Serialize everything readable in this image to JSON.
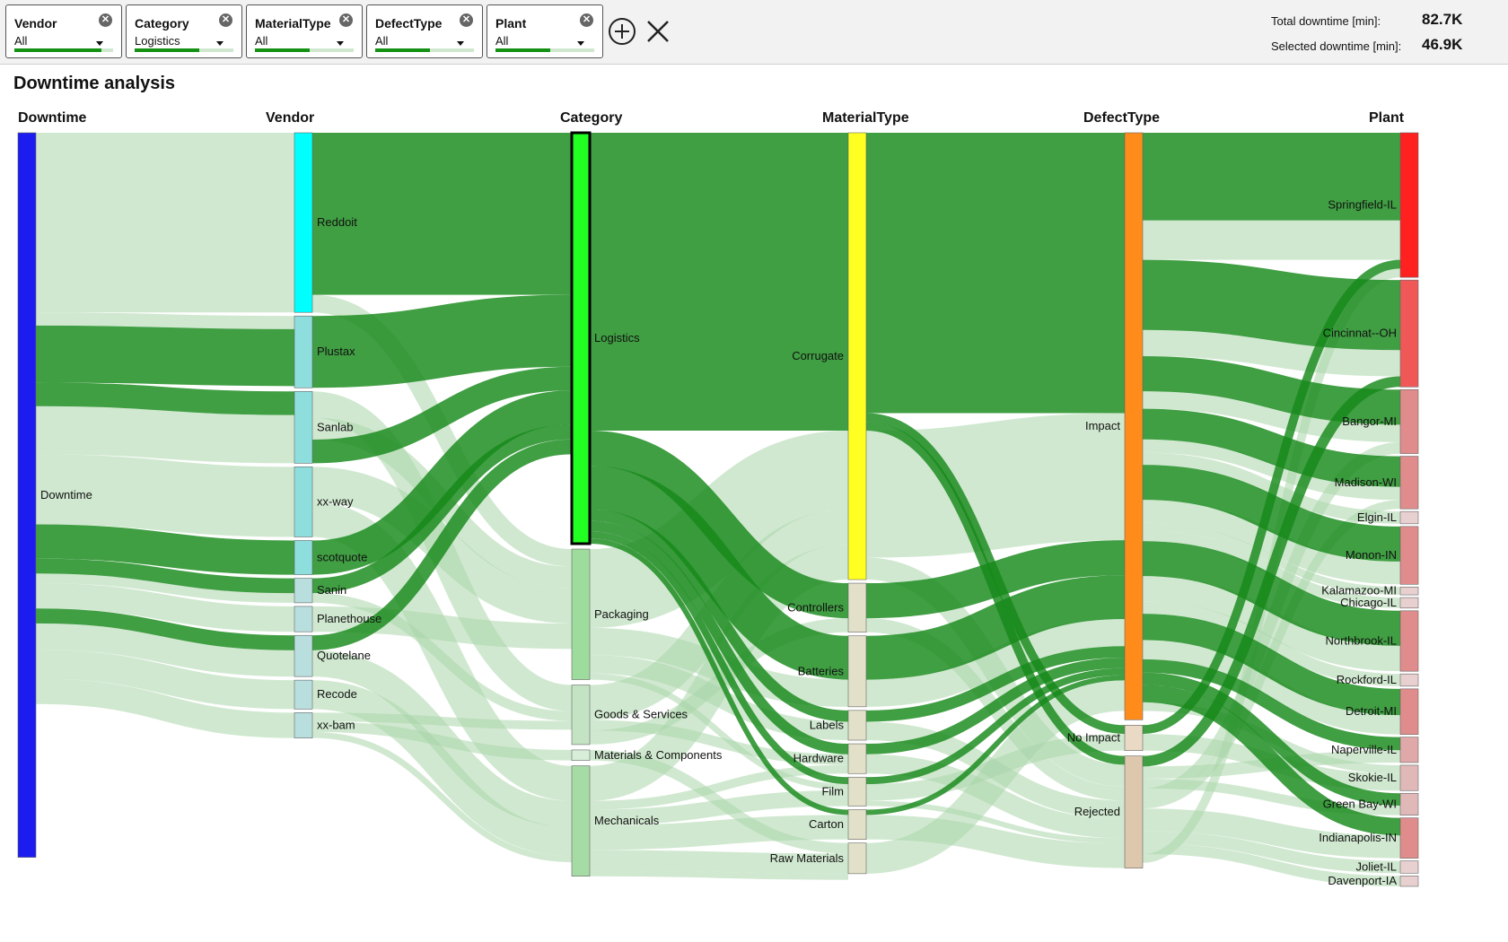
{
  "filters": [
    {
      "name": "Vendor",
      "value": "All",
      "fill": 0.88
    },
    {
      "name": "Category",
      "value": "Logistics",
      "fill": 0.65
    },
    {
      "name": "MaterialType",
      "value": "All",
      "fill": 0.55
    },
    {
      "name": "DefectType",
      "value": "All",
      "fill": 0.55
    },
    {
      "name": "Plant",
      "value": "All",
      "fill": 0.55
    }
  ],
  "totals": {
    "total_label": "Total downtime [min]:",
    "total_value": "82.7K",
    "selected_label": "Selected downtime [min]:",
    "selected_value": "46.9K"
  },
  "title": "Downtime analysis",
  "colors": {
    "link_selected": "#16891a",
    "link_other": "#a9d6a9",
    "highlight": "#22ff22"
  },
  "chart_data": {
    "type": "sankey",
    "columns": [
      "Downtime",
      "Vendor",
      "Category",
      "MaterialType",
      "DefectType",
      "Plant"
    ],
    "nodes": [
      {
        "col": 0,
        "label": "Downtime",
        "value": 82.7,
        "color": "#1c1cf0"
      },
      {
        "col": 1,
        "label": "Reddoit",
        "value": 20.5,
        "color": "#00ffff"
      },
      {
        "col": 1,
        "label": "Plustax",
        "value": 8.2,
        "color": "#8fdede"
      },
      {
        "col": 1,
        "label": "Sanlab",
        "value": 8.2,
        "color": "#8fdede"
      },
      {
        "col": 1,
        "label": "xx-way",
        "value": 8.0,
        "color": "#8fdede"
      },
      {
        "col": 1,
        "label": "scotquote",
        "value": 3.9,
        "color": "#8fdede"
      },
      {
        "col": 1,
        "label": "Sanin",
        "value": 2.8,
        "color": "#b9dede"
      },
      {
        "col": 1,
        "label": "Planethouse",
        "value": 2.9,
        "color": "#b9dede"
      },
      {
        "col": 1,
        "label": "Quotelane",
        "value": 4.7,
        "color": "#b9dede"
      },
      {
        "col": 1,
        "label": "Recode",
        "value": 3.3,
        "color": "#b9dede"
      },
      {
        "col": 1,
        "label": "xx-bam",
        "value": 2.9,
        "color": "#b9dede"
      },
      {
        "col": 2,
        "label": "Logistics",
        "value": 46.9,
        "color": "#22ff22"
      },
      {
        "col": 2,
        "label": "Packaging",
        "value": 14.9,
        "color": "#9ddc9d"
      },
      {
        "col": 2,
        "label": "Goods & Services",
        "value": 6.8,
        "color": "#c3e3c3"
      },
      {
        "col": 2,
        "label": "Materials & Components",
        "value": 1.2,
        "color": "#d9eed9"
      },
      {
        "col": 2,
        "label": "Mechanicals",
        "value": 12.6,
        "color": "#a6dba6"
      },
      {
        "col": 3,
        "label": "Corrugate",
        "value": 51.0,
        "color": "#ffff22"
      },
      {
        "col": 3,
        "label": "Controllers",
        "value": 5.6,
        "color": "#e2e0c8"
      },
      {
        "col": 3,
        "label": "Batteries",
        "value": 8.1,
        "color": "#e2e0c8"
      },
      {
        "col": 3,
        "label": "Labels",
        "value": 3.4,
        "color": "#e2e0c8"
      },
      {
        "col": 3,
        "label": "Hardware",
        "value": 3.4,
        "color": "#e2e0c8"
      },
      {
        "col": 3,
        "label": "Film",
        "value": 3.3,
        "color": "#e2e0c8"
      },
      {
        "col": 3,
        "label": "Carton",
        "value": 3.4,
        "color": "#e2e0c8"
      },
      {
        "col": 3,
        "label": "Raw Materials",
        "value": 3.5,
        "color": "#e2e0c8"
      },
      {
        "col": 4,
        "label": "Impact",
        "value": 67.0,
        "color": "#ff8c1a"
      },
      {
        "col": 4,
        "label": "No Impact",
        "value": 2.9,
        "color": "#ead9c4"
      },
      {
        "col": 4,
        "label": "Rejected",
        "value": 12.8,
        "color": "#ddc7ad"
      },
      {
        "col": 5,
        "label": "Springfield-IL",
        "value": 16.5,
        "color": "#ff2020"
      },
      {
        "col": 5,
        "label": "Cincinnat--OH",
        "value": 12.2,
        "color": "#f05858"
      },
      {
        "col": 5,
        "label": "Bangor-MI",
        "value": 7.3,
        "color": "#e08c8c"
      },
      {
        "col": 5,
        "label": "Madison-WI",
        "value": 6.0,
        "color": "#e08c8c"
      },
      {
        "col": 5,
        "label": "Elgin-IL",
        "value": 1.4,
        "color": "#e8d0d0"
      },
      {
        "col": 5,
        "label": "Monon-IN",
        "value": 6.6,
        "color": "#e08c8c"
      },
      {
        "col": 5,
        "label": "Kalamazoo-MI",
        "value": 0.9,
        "color": "#e8d0d0"
      },
      {
        "col": 5,
        "label": "Chicago-IL",
        "value": 1.2,
        "color": "#e8d0d0"
      },
      {
        "col": 5,
        "label": "Northbrook-IL",
        "value": 6.9,
        "color": "#e08c8c"
      },
      {
        "col": 5,
        "label": "Rockford-IL",
        "value": 1.4,
        "color": "#e8d0d0"
      },
      {
        "col": 5,
        "label": "Detroit-MI",
        "value": 5.2,
        "color": "#e08c8c"
      },
      {
        "col": 5,
        "label": "Naperville-IL",
        "value": 2.9,
        "color": "#e0a8a8"
      },
      {
        "col": 5,
        "label": "Skokie-IL",
        "value": 2.9,
        "color": "#e0b8b8"
      },
      {
        "col": 5,
        "label": "Green Bay-WI",
        "value": 2.5,
        "color": "#e0b8b8"
      },
      {
        "col": 5,
        "label": "Indianapolis-IN",
        "value": 4.6,
        "color": "#e08c8c"
      },
      {
        "col": 5,
        "label": "Joliet-IL",
        "value": 1.4,
        "color": "#e8d0d0"
      },
      {
        "col": 5,
        "label": "Davenport-IA",
        "value": 1.2,
        "color": "#e8d0d0"
      }
    ],
    "links": [
      {
        "from": "Downtime",
        "to": "Reddoit",
        "value": 20.5,
        "selected": false
      },
      {
        "from": "Downtime",
        "to": "Plustax",
        "value": 1.5,
        "selected": false
      },
      {
        "from": "Downtime",
        "to": "Plustax",
        "value": 6.5,
        "selected": true
      },
      {
        "from": "Downtime",
        "to": "Sanlab",
        "value": 2.7,
        "selected": true
      },
      {
        "from": "Downtime",
        "to": "Sanlab",
        "value": 5.5,
        "selected": false
      },
      {
        "from": "Downtime",
        "to": "xx-way",
        "value": 8.0,
        "selected": false
      },
      {
        "from": "Downtime",
        "to": "scotquote",
        "value": 3.9,
        "selected": true
      },
      {
        "from": "Downtime",
        "to": "Sanin",
        "value": 1.7,
        "selected": true
      },
      {
        "from": "Downtime",
        "to": "Sanin",
        "value": 1.1,
        "selected": false
      },
      {
        "from": "Downtime",
        "to": "Planethouse",
        "value": 2.9,
        "selected": false
      },
      {
        "from": "Downtime",
        "to": "Quotelane",
        "value": 1.7,
        "selected": true
      },
      {
        "from": "Downtime",
        "to": "Quotelane",
        "value": 3.0,
        "selected": false
      },
      {
        "from": "Downtime",
        "to": "Recode",
        "value": 3.3,
        "selected": false
      },
      {
        "from": "Downtime",
        "to": "xx-bam",
        "value": 2.9,
        "selected": false
      },
      {
        "from": "Reddoit",
        "to": "Logistics",
        "value": 18.5,
        "selected": true
      },
      {
        "from": "Reddoit",
        "to": "Packaging",
        "value": 2.0,
        "selected": false
      },
      {
        "from": "Plustax",
        "to": "Logistics",
        "value": 8.2,
        "selected": true
      },
      {
        "from": "Sanlab",
        "to": "Goods & Services",
        "value": 3.0,
        "selected": false
      },
      {
        "from": "Sanlab",
        "to": "Packaging",
        "value": 2.5,
        "selected": false
      },
      {
        "from": "Sanlab",
        "to": "Logistics",
        "value": 2.7,
        "selected": true
      },
      {
        "from": "xx-way",
        "to": "Packaging",
        "value": 4.0,
        "selected": false
      },
      {
        "from": "xx-way",
        "to": "Mechanicals",
        "value": 4.0,
        "selected": false
      },
      {
        "from": "scotquote",
        "to": "Logistics",
        "value": 3.9,
        "selected": true
      },
      {
        "from": "Sanin",
        "to": "Logistics",
        "value": 1.7,
        "selected": true
      },
      {
        "from": "Sanin",
        "to": "Goods & Services",
        "value": 1.1,
        "selected": false
      },
      {
        "from": "Planethouse",
        "to": "Packaging",
        "value": 2.9,
        "selected": false
      },
      {
        "from": "Quotelane",
        "to": "Logistics",
        "value": 1.7,
        "selected": true
      },
      {
        "from": "Quotelane",
        "to": "Mechanicals",
        "value": 3.0,
        "selected": false
      },
      {
        "from": "Recode",
        "to": "Mechanicals",
        "value": 3.3,
        "selected": false
      },
      {
        "from": "xx-bam",
        "to": "Goods & Services",
        "value": 1.0,
        "selected": false
      },
      {
        "from": "xx-bam",
        "to": "Materials & Components",
        "value": 1.2,
        "selected": false
      },
      {
        "from": "xx-bam",
        "to": "Mechanicals",
        "value": 0.7,
        "selected": false
      },
      {
        "from": "Logistics",
        "to": "Corrugate",
        "value": 34.0,
        "selected": true
      },
      {
        "from": "Logistics",
        "to": "Controllers",
        "value": 4.0,
        "selected": true
      },
      {
        "from": "Logistics",
        "to": "Batteries",
        "value": 5.0,
        "selected": true
      },
      {
        "from": "Logistics",
        "to": "Labels",
        "value": 1.3,
        "selected": true
      },
      {
        "from": "Logistics",
        "to": "Hardware",
        "value": 1.2,
        "selected": true
      },
      {
        "from": "Logistics",
        "to": "Film",
        "value": 0.8,
        "selected": true
      },
      {
        "from": "Logistics",
        "to": "Carton",
        "value": 0.6,
        "selected": true
      },
      {
        "from": "Packaging",
        "to": "Corrugate",
        "value": 9.0,
        "selected": false
      },
      {
        "from": "Packaging",
        "to": "Batteries",
        "value": 3.1,
        "selected": false
      },
      {
        "from": "Packaging",
        "to": "Labels",
        "value": 2.1,
        "selected": false
      },
      {
        "from": "Packaging",
        "to": "Film",
        "value": 0.7,
        "selected": false
      },
      {
        "from": "Goods & Services",
        "to": "Corrugate",
        "value": 4.0,
        "selected": false
      },
      {
        "from": "Goods & Services",
        "to": "Hardware",
        "value": 1.2,
        "selected": false
      },
      {
        "from": "Goods & Services",
        "to": "Controllers",
        "value": 1.6,
        "selected": false
      },
      {
        "from": "Materials & Components",
        "to": "Raw Materials",
        "value": 1.2,
        "selected": false
      },
      {
        "from": "Mechanicals",
        "to": "Corrugate",
        "value": 4.0,
        "selected": false
      },
      {
        "from": "Mechanicals",
        "to": "Hardware",
        "value": 1.0,
        "selected": false
      },
      {
        "from": "Mechanicals",
        "to": "Film",
        "value": 1.8,
        "selected": false
      },
      {
        "from": "Mechanicals",
        "to": "Carton",
        "value": 2.8,
        "selected": false
      },
      {
        "from": "Mechanicals",
        "to": "Raw Materials",
        "value": 2.3,
        "selected": false
      },
      {
        "from": "Mechanicals",
        "to": "Raw Materials",
        "value": 0.7,
        "selected": false
      },
      {
        "from": "Corrugate",
        "to": "Impact",
        "value": 32.0,
        "selected": true
      },
      {
        "from": "Corrugate",
        "to": "No Impact",
        "value": 1.0,
        "selected": true
      },
      {
        "from": "Corrugate",
        "to": "Rejected",
        "value": 1.0,
        "selected": true
      },
      {
        "from": "Corrugate",
        "to": "Impact",
        "value": 14.5,
        "selected": false
      },
      {
        "from": "Corrugate",
        "to": "Rejected",
        "value": 2.5,
        "selected": false
      },
      {
        "from": "Controllers",
        "to": "Impact",
        "value": 4.0,
        "selected": true
      },
      {
        "from": "Controllers",
        "to": "Rejected",
        "value": 1.6,
        "selected": false
      },
      {
        "from": "Batteries",
        "to": "Impact",
        "value": 5.0,
        "selected": true
      },
      {
        "from": "Batteries",
        "to": "Impact",
        "value": 3.1,
        "selected": false
      },
      {
        "from": "Labels",
        "to": "Impact",
        "value": 1.3,
        "selected": true
      },
      {
        "from": "Labels",
        "to": "Rejected",
        "value": 2.1,
        "selected": false
      },
      {
        "from": "Hardware",
        "to": "Impact",
        "value": 1.2,
        "selected": true
      },
      {
        "from": "Hardware",
        "to": "Rejected",
        "value": 2.2,
        "selected": false
      },
      {
        "from": "Film",
        "to": "Impact",
        "value": 0.8,
        "selected": true
      },
      {
        "from": "Film",
        "to": "No Impact",
        "value": 1.9,
        "selected": false
      },
      {
        "from": "Film",
        "to": "Rejected",
        "value": 0.6,
        "selected": false
      },
      {
        "from": "Carton",
        "to": "Impact",
        "value": 0.6,
        "selected": true
      },
      {
        "from": "Carton",
        "to": "Rejected",
        "value": 2.8,
        "selected": false
      },
      {
        "from": "Raw Materials",
        "to": "Impact",
        "value": 3.5,
        "selected": false
      },
      {
        "from": "Impact",
        "to": "Springfield-IL",
        "value": 10.0,
        "selected": true
      },
      {
        "from": "Impact",
        "to": "Springfield-IL",
        "value": 4.5,
        "selected": false
      },
      {
        "from": "Impact",
        "to": "Cincinnat--OH",
        "value": 8.0,
        "selected": true
      },
      {
        "from": "Impact",
        "to": "Cincinnat--OH",
        "value": 3.0,
        "selected": false
      },
      {
        "from": "Impact",
        "to": "Bangor-MI",
        "value": 4.0,
        "selected": true
      },
      {
        "from": "Impact",
        "to": "Bangor-MI",
        "value": 2.0,
        "selected": false
      },
      {
        "from": "Impact",
        "to": "Madison-WI",
        "value": 3.5,
        "selected": true
      },
      {
        "from": "Impact",
        "to": "Madison-WI",
        "value": 1.5,
        "selected": false
      },
      {
        "from": "Impact",
        "to": "Elgin-IL",
        "value": 1.4,
        "selected": false
      },
      {
        "from": "Impact",
        "to": "Monon-IN",
        "value": 4.0,
        "selected": true
      },
      {
        "from": "Impact",
        "to": "Monon-IN",
        "value": 2.6,
        "selected": false
      },
      {
        "from": "Impact",
        "to": "Kalamazoo-MI",
        "value": 0.9,
        "selected": false
      },
      {
        "from": "Impact",
        "to": "Chicago-IL",
        "value": 1.2,
        "selected": false
      },
      {
        "from": "Impact",
        "to": "Northbrook-IL",
        "value": 4.0,
        "selected": true
      },
      {
        "from": "Impact",
        "to": "Northbrook-IL",
        "value": 2.9,
        "selected": false
      },
      {
        "from": "Impact",
        "to": "Rockford-IL",
        "value": 1.4,
        "selected": false
      },
      {
        "from": "Impact",
        "to": "Detroit-MI",
        "value": 3.0,
        "selected": true
      },
      {
        "from": "Impact",
        "to": "Detroit-MI",
        "value": 2.2,
        "selected": false
      },
      {
        "from": "Impact",
        "to": "Naperville-IL",
        "value": 1.5,
        "selected": true
      },
      {
        "from": "Impact",
        "to": "Green Bay-WI",
        "value": 1.4,
        "selected": true
      },
      {
        "from": "Impact",
        "to": "Indianapolis-IN",
        "value": 2.0,
        "selected": true
      },
      {
        "from": "Impact",
        "to": "Skokie-IL",
        "value": 1.0,
        "selected": false
      },
      {
        "from": "No Impact",
        "to": "Springfield-IL",
        "value": 1.0,
        "selected": true
      },
      {
        "from": "No Impact",
        "to": "Skokie-IL",
        "value": 1.9,
        "selected": false
      },
      {
        "from": "Rejected",
        "to": "Cincinnat--OH",
        "value": 1.2,
        "selected": true
      },
      {
        "from": "Rejected",
        "to": "Naperville-IL",
        "value": 1.4,
        "selected": false
      },
      {
        "from": "Rejected",
        "to": "Green Bay-WI",
        "value": 1.1,
        "selected": false
      },
      {
        "from": "Rejected",
        "to": "Bangor-MI",
        "value": 1.3,
        "selected": false
      },
      {
        "from": "Rejected",
        "to": "Madison-WI",
        "value": 1.0,
        "selected": false
      },
      {
        "from": "Rejected",
        "to": "Indianapolis-IN",
        "value": 2.6,
        "selected": false
      },
      {
        "from": "Rejected",
        "to": "Joliet-IL",
        "value": 1.4,
        "selected": false
      },
      {
        "from": "Rejected",
        "to": "Davenport-IA",
        "value": 1.2,
        "selected": false
      },
      {
        "from": "Rejected",
        "to": "Springfield-IL",
        "value": 1.0,
        "selected": false
      }
    ]
  }
}
